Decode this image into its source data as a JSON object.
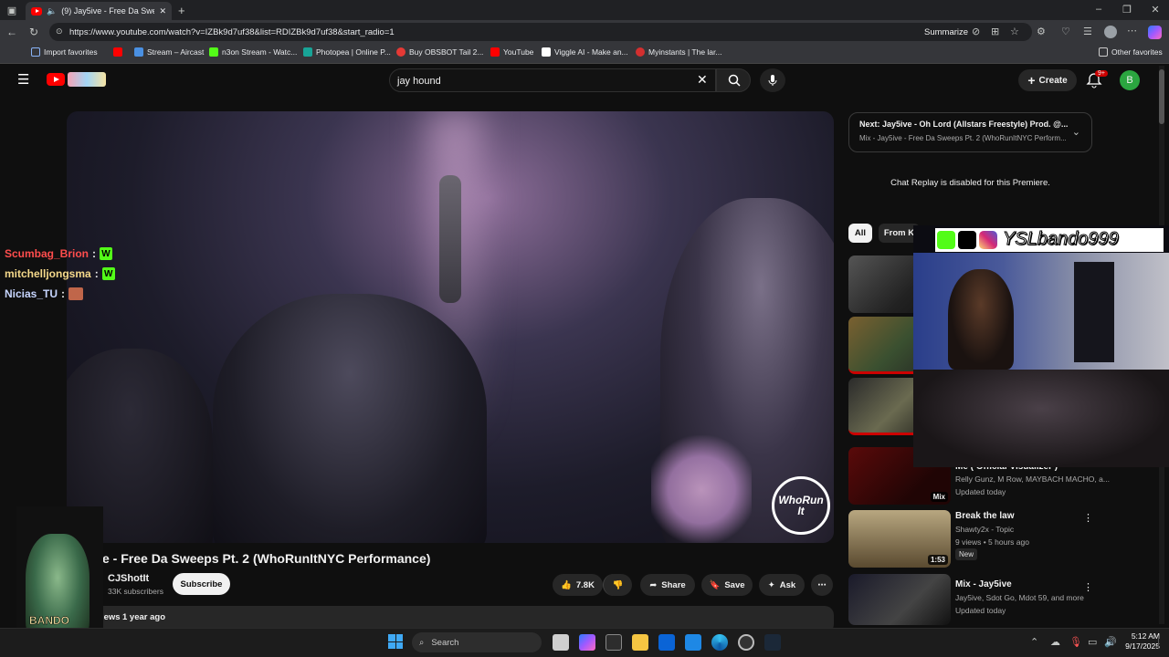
{
  "browser": {
    "tab_title": "(9) Jay5ive - Free Da Sweeps",
    "url": "https://www.youtube.com/watch?v=IZBk9d7uf38&list=RDIZBk9d7uf38&start_radio=1",
    "summarize_label": "Summarize",
    "bookmarks": [
      {
        "label": "Import favorites",
        "color": "#8ab4f8"
      },
      {
        "label": "Stream – Aircast",
        "color": "#4a90e2"
      },
      {
        "label": "n3on Stream - Watc...",
        "color": "#53fc18"
      },
      {
        "label": "Photopea | Online P...",
        "color": "#18a497"
      },
      {
        "label": "Buy OBSBOT Tail 2...",
        "color": "#e53935"
      },
      {
        "label": "YouTube",
        "color": "#ff0000"
      },
      {
        "label": "Viggle AI - Make an...",
        "color": "#ffffff"
      },
      {
        "label": "Myinstants | The lar...",
        "color": "#d32f2f"
      }
    ],
    "other_favorites": "Other favorites"
  },
  "youtube": {
    "search_value": "jay hound",
    "create_label": "Create",
    "notif_count": "9+",
    "avatar_letter": "B",
    "video_title": "e - Free Da Sweeps Pt. 2 (WhoRunItNYC Performance)",
    "watermark": "WhoRun It",
    "channel_name": "CJShotIt",
    "subscribers": "33K subscribers",
    "subscribe_label": "Subscribe",
    "likes": "7.8K",
    "share_label": "Share",
    "save_label": "Save",
    "ask_label": "Ask",
    "views_partial": "iews",
    "upload_date": "1 year ago",
    "next_title": "Next: Jay5ive - Oh Lord (Allstars Freestyle) Prod. @...",
    "next_sub": "Mix - Jay5ive - Free Da Sweeps Pt. 2 (WhoRunItNYC Perform...",
    "chat_replay": "Chat Replay is disabled for this Premiere.",
    "chips": [
      "All",
      "From K"
    ],
    "recs": [
      {
        "title": "Me ( Official Visualizer )",
        "meta1": "Relly Gunz, M Row, MAYBACH MACHO, a...",
        "meta2": "Updated today",
        "badge": "Mix"
      },
      {
        "title": "Break the law",
        "meta1": "Shawty2x - Topic",
        "meta2": "9 views • 5 hours ago",
        "badge_new": "New",
        "duration": "1:53"
      },
      {
        "title": "Mix - Jay5ive",
        "meta1": "Jay5ive, Sdot Go, Mdot 59, and more",
        "meta2": "Updated today"
      }
    ]
  },
  "chat_overlay": [
    {
      "user": "Scumbag_Brion",
      "color": "#ff4d4d",
      "emote": "W"
    },
    {
      "user": "mitchelljongsma",
      "color": "#f5d98b",
      "emote": "W"
    },
    {
      "user": "Nicias_TU",
      "color": "#c7d6ff",
      "emote": ""
    }
  ],
  "stream_overlay": {
    "handle": "YSLbando999"
  },
  "sticker_text": "BANDO",
  "taskbar": {
    "search": "Search",
    "time": "5:12 AM",
    "date": "9/17/2025"
  }
}
